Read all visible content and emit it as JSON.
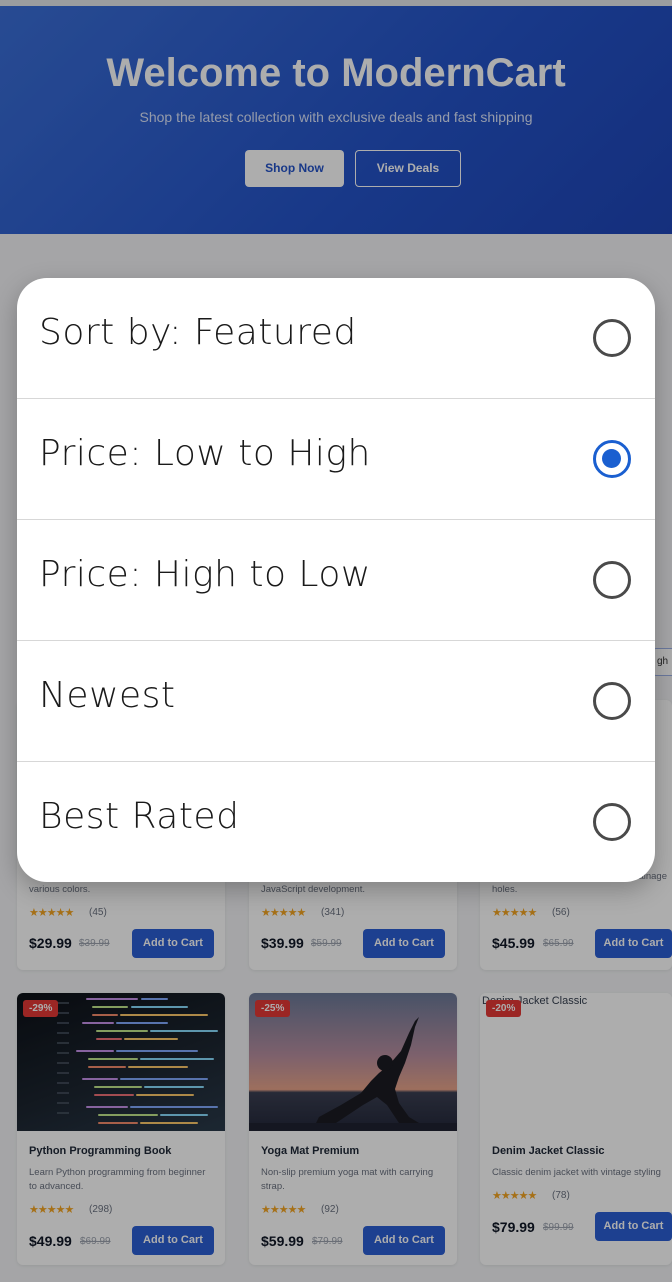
{
  "hero": {
    "title": "Welcome to ModernCart",
    "subtitle": "Shop the latest collection with exclusive deals and fast shipping",
    "shop_now": "Shop Now",
    "view_deals": "View Deals"
  },
  "sort_input_partial": "gh",
  "products_row1": [
    {
      "desc_fragment": "various colors.",
      "stars": "★★★★★",
      "reviews": "(45)",
      "price": "$29.99",
      "old_price": "$39.99",
      "add": "Add to Cart"
    },
    {
      "desc_fragment": "JavaScript development.",
      "stars": "★★★★★",
      "reviews": "(341)",
      "price": "$39.99",
      "old_price": "$59.99",
      "add": "Add to Cart"
    },
    {
      "desc_fragment": "holes.",
      "desc_fragment_right": "drainage",
      "stars": "★★★★★",
      "reviews": "(56)",
      "price": "$45.99",
      "old_price": "$65.99",
      "add": "Add to Cart"
    }
  ],
  "products_row2": [
    {
      "badge": "-29%",
      "name": "Python Programming Book",
      "desc": "Learn Python programming from beginner to advanced.",
      "stars": "★★★★★",
      "reviews": "(298)",
      "price": "$49.99",
      "old_price": "$69.99",
      "add": "Add to Cart"
    },
    {
      "badge": "-25%",
      "name": "Yoga Mat Premium",
      "desc": "Non-slip premium yoga mat with carrying strap.",
      "stars": "★★★★★",
      "reviews": "(92)",
      "price": "$59.99",
      "old_price": "$79.99",
      "add": "Add to Cart"
    },
    {
      "badge": "-20%",
      "alt_text": "Denim Jacket Classic",
      "name": "Denim Jacket Classic",
      "desc": "Classic denim jacket with vintage styling",
      "stars": "★★★★★",
      "reviews": "(78)",
      "price": "$79.99",
      "old_price": "$99.99",
      "add": "Add to Cart"
    }
  ],
  "sort_dialog": {
    "options": [
      {
        "label": "Sort by: Featured",
        "selected": false
      },
      {
        "label": "Price: Low to High",
        "selected": true
      },
      {
        "label": "Price: High to Low",
        "selected": false
      },
      {
        "label": "Newest",
        "selected": false
      },
      {
        "label": "Best Rated",
        "selected": false
      }
    ]
  },
  "colors": {
    "accent": "#1a5fd0",
    "hero": "#2453c9",
    "badge": "#e53935",
    "button": "#2c5fd4"
  }
}
